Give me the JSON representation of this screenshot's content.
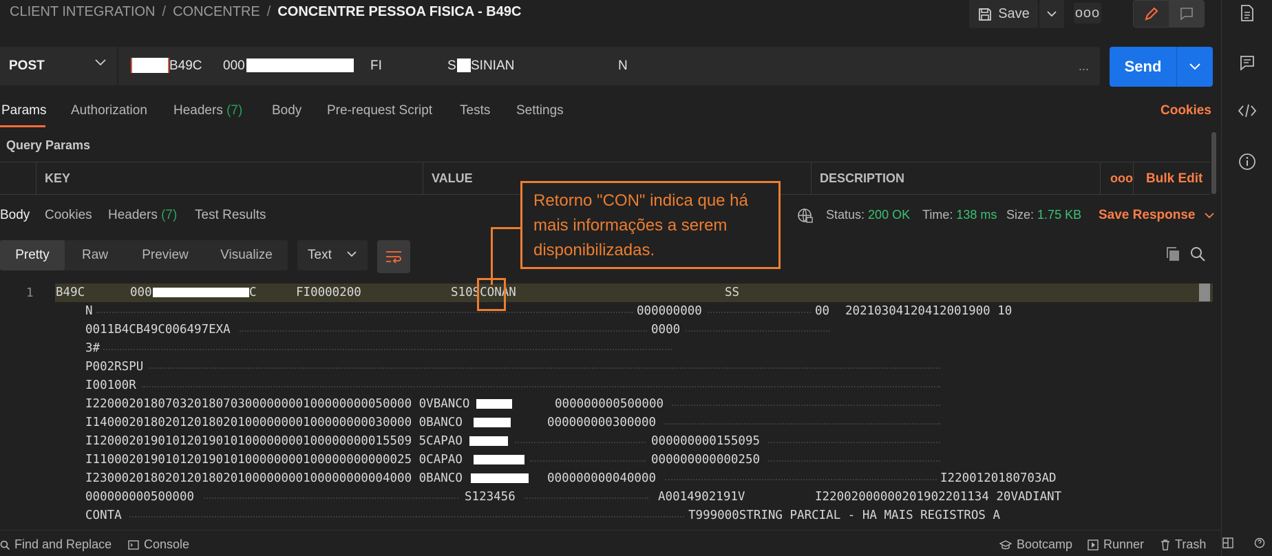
{
  "breadcrumb": {
    "items": [
      "CLIENT INTEGRATION",
      "CONCENTRE"
    ],
    "separator": "/",
    "current": "CONCENTRE PESSOA FISICA - B49C"
  },
  "toolbar": {
    "save_label": "Save",
    "more_label": "ooo"
  },
  "request": {
    "method": "POST",
    "url_segments": [
      "B49C",
      "000",
      "FI",
      "S",
      "SINIAN",
      "N"
    ],
    "url_more": "...",
    "send_label": "Send"
  },
  "request_tabs": [
    {
      "label": "Params",
      "count": ""
    },
    {
      "label": "Authorization",
      "count": ""
    },
    {
      "label": "Headers",
      "count": "(7)"
    },
    {
      "label": "Body",
      "count": ""
    },
    {
      "label": "Pre-request Script",
      "count": ""
    },
    {
      "label": "Tests",
      "count": ""
    },
    {
      "label": "Settings",
      "count": ""
    }
  ],
  "cookies_label": "Cookies",
  "query_params": {
    "title": "Query Params",
    "columns": [
      "KEY",
      "VALUE",
      "DESCRIPTION"
    ],
    "more_label": "ooo",
    "bulk_edit_label": "Bulk Edit"
  },
  "response": {
    "tabs": [
      {
        "label": "Body",
        "count": ""
      },
      {
        "label": "Cookies",
        "count": ""
      },
      {
        "label": "Headers",
        "count": "(7)"
      },
      {
        "label": "Test Results",
        "count": ""
      }
    ],
    "status_label": "Status:",
    "status_value": "200 OK",
    "time_label": "Time:",
    "time_value": "138 ms",
    "size_label": "Size:",
    "size_value": "1.75 KB",
    "save_response_label": "Save Response",
    "formats": [
      "Pretty",
      "Raw",
      "Preview",
      "Visualize"
    ],
    "content_type": "Text",
    "line_number": "1",
    "lines": [
      [
        "B49C",
        "000",
        "C",
        "FI0000200",
        "S10SCONAN",
        "SS"
      ],
      [
        "N",
        "000000000",
        "00",
        "20210304120412001900 10"
      ],
      [
        "0011B4CB49C006497EXA",
        "0000"
      ],
      [
        "3#"
      ],
      [
        "P002RSPU"
      ],
      [
        "I00100R"
      ],
      [
        "I22000201807032018070300000000100000000050000 0VBANCO",
        "000000000500000"
      ],
      [
        "I14000201802012018020100000000100000000030000 0BANCO",
        "000000000300000"
      ],
      [
        "I12000201901012019010100000000100000000015509 5CAPAO",
        "000000000155095"
      ],
      [
        "I11000201901012019010100000000100000000000025 0CAPAO",
        "000000000000250"
      ],
      [
        "I23000201802012018020100000000100000000004000 0BANCO",
        "000000000040000",
        "I2200120180703AD"
      ],
      [
        "000000000500000",
        "S123456",
        "A0014902191V",
        "I22002000000201902201134 20VADIANT"
      ],
      [
        "CONTA",
        "T999000STRING PARCIAL - HA MAIS REGISTROS A"
      ]
    ]
  },
  "annotation": "Retorno \"CON\" indica que há mais informações a serem disponibilizadas.",
  "footer": {
    "left": [
      "Find and Replace",
      "Console"
    ],
    "right": [
      "Bootcamp",
      "Runner",
      "Trash"
    ]
  },
  "colors": {
    "accent": "#ff6c37",
    "send": "#1a73e8",
    "success": "#3cc174",
    "annotation": "#ed7d31"
  }
}
